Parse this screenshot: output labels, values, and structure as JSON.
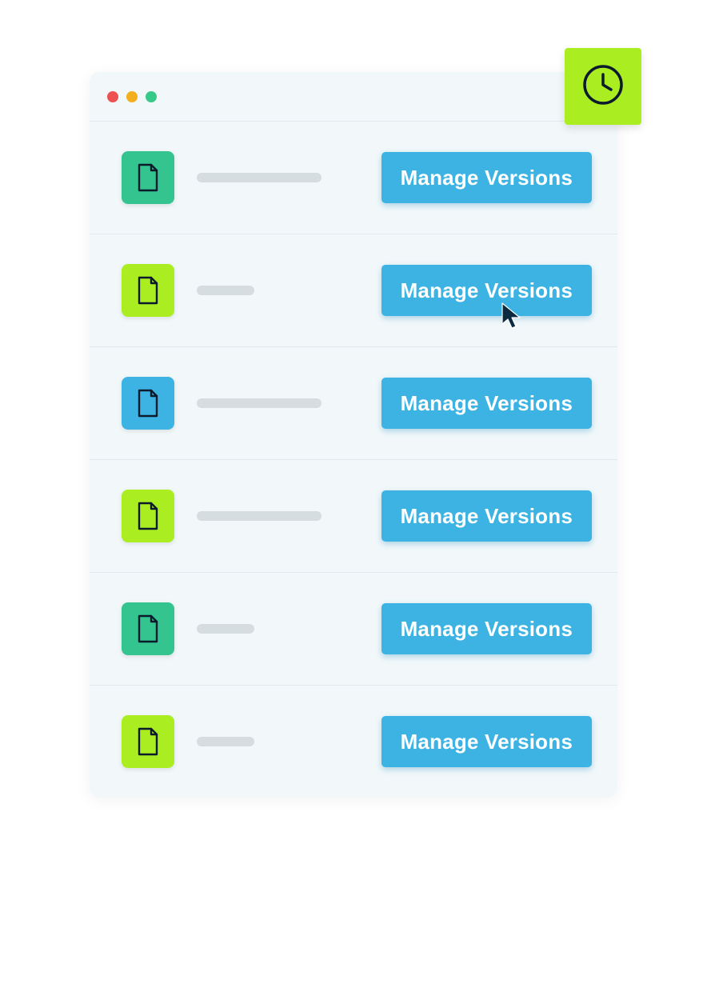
{
  "badge": {
    "icon": "clock-icon"
  },
  "colors": {
    "teal": "#33c490",
    "lime": "#aaee22",
    "blue": "#3db3e3"
  },
  "rows": [
    {
      "icon_bg": "teal",
      "placeholder_w": 156,
      "button_label": "Manage Versions"
    },
    {
      "icon_bg": "lime",
      "placeholder_w": 72,
      "button_label": "Manage Versions",
      "cursor": true
    },
    {
      "icon_bg": "blue",
      "placeholder_w": 156,
      "button_label": "Manage Versions"
    },
    {
      "icon_bg": "lime",
      "placeholder_w": 156,
      "button_label": "Manage Versions"
    },
    {
      "icon_bg": "teal",
      "placeholder_w": 72,
      "button_label": "Manage Versions"
    },
    {
      "icon_bg": "lime",
      "placeholder_w": 72,
      "button_label": "Manage Versions"
    }
  ]
}
